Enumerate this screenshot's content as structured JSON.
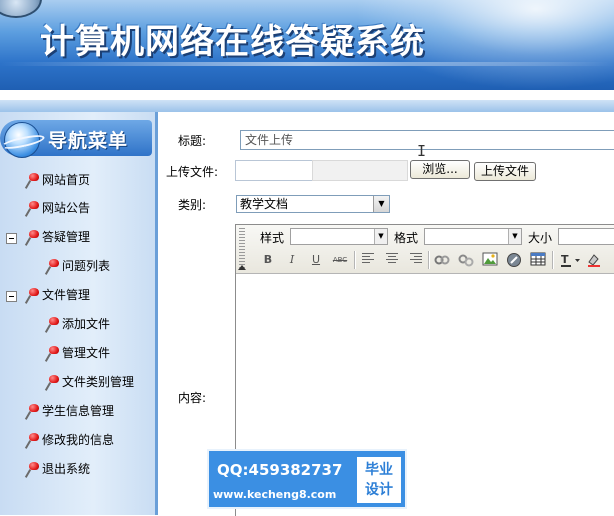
{
  "banner": {
    "title": "计算机网络在线答疑系统"
  },
  "sidebar": {
    "header": "导航菜单",
    "items": [
      {
        "label": "网站首页",
        "level": 0
      },
      {
        "label": "网站公告",
        "level": 0
      },
      {
        "label": "答疑管理",
        "level": 0,
        "expanded": true
      },
      {
        "label": "问题列表",
        "level": 1
      },
      {
        "label": "文件管理",
        "level": 0,
        "expanded": true
      },
      {
        "label": "添加文件",
        "level": 1
      },
      {
        "label": "管理文件",
        "level": 1
      },
      {
        "label": "文件类别管理",
        "level": 1
      },
      {
        "label": "学生信息管理",
        "level": 0
      },
      {
        "label": "修改我的信息",
        "level": 0
      },
      {
        "label": "退出系统",
        "level": 0
      }
    ]
  },
  "form": {
    "title_label": "标题:",
    "title_value": "文件上传",
    "upload_label": "上传文件:",
    "browse_button": "浏览...",
    "upload_button": "上传文件",
    "category_label": "类别:",
    "category_value": "教学文档",
    "content_label": "内容:"
  },
  "editor": {
    "style_label": "样式",
    "format_label": "格式",
    "size_label": "大小",
    "buttons": [
      "B",
      "I",
      "U",
      "ABC"
    ]
  },
  "watermark": {
    "qq": "QQ:459382737",
    "site": "www.kecheng8.com",
    "badge_line1": "毕业",
    "badge_line2": "设计"
  }
}
